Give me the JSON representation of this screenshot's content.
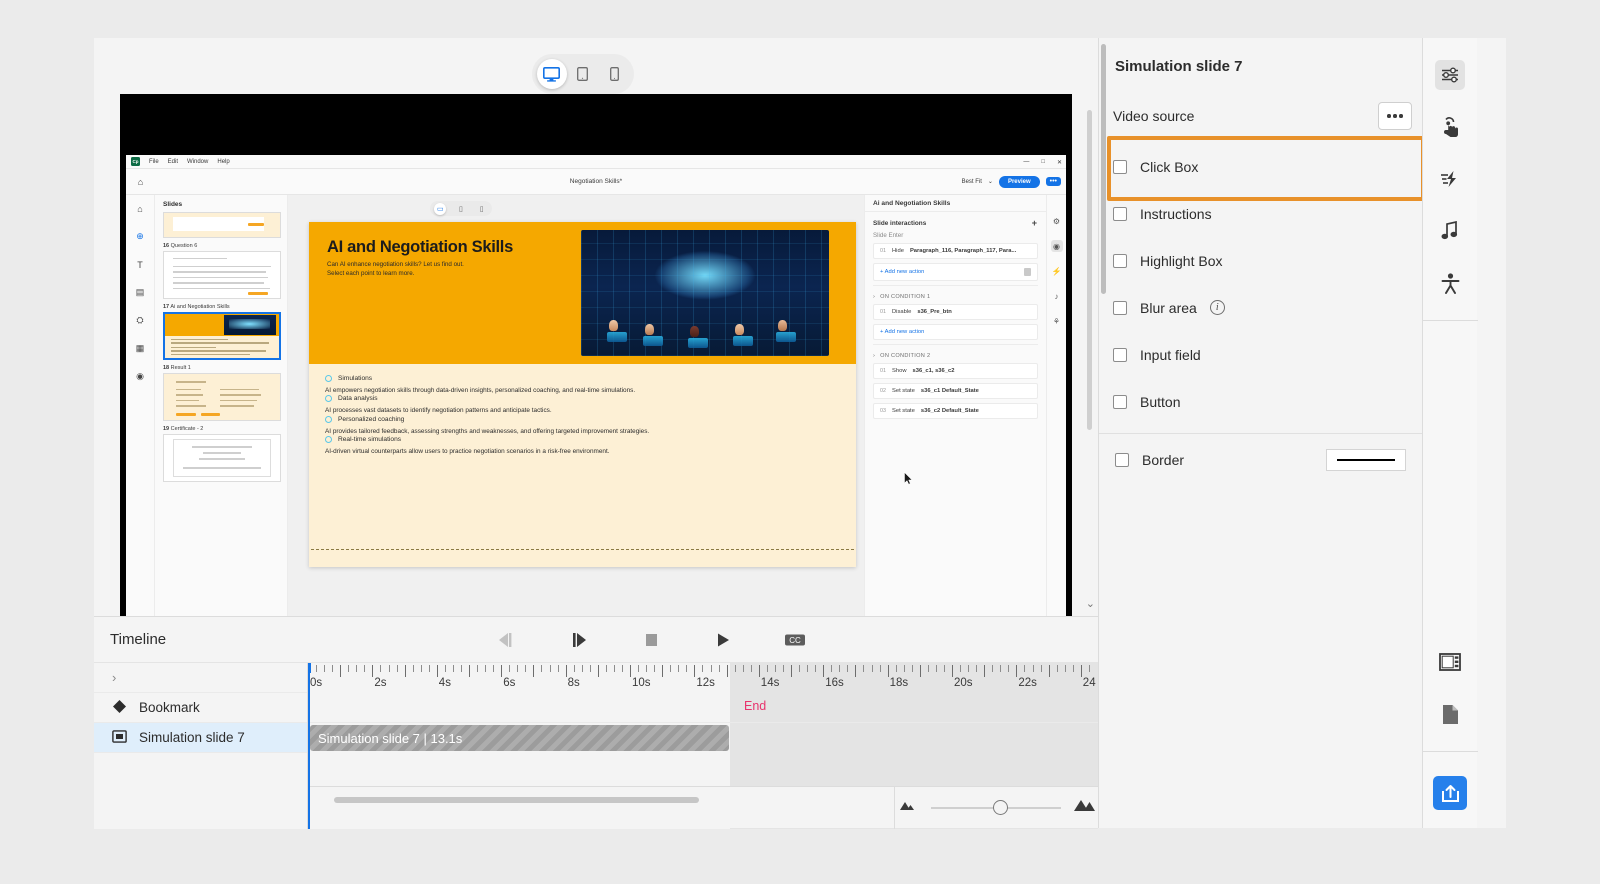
{
  "stage": {
    "devices": [
      {
        "name": "desktop",
        "label": "Desktop",
        "selected": true
      },
      {
        "name": "tablet",
        "label": "Tablet",
        "selected": false
      },
      {
        "name": "mobile",
        "label": "Mobile",
        "selected": false
      }
    ]
  },
  "inner_app": {
    "menubar": {
      "logo": "Cp",
      "items": [
        "File",
        "Edit",
        "Window",
        "Help"
      ]
    },
    "window_controls": [
      "—",
      "□",
      "✕"
    ],
    "doc_title": "Negotiation Skills*",
    "zoom_select": "Best Fit",
    "preview_label": "Preview",
    "more_label": "•••",
    "rail_icons": [
      "home-icon",
      "add-icon",
      "text-icon",
      "media-icon",
      "interaction-icon",
      "widgets-icon",
      "states-icon"
    ],
    "slides_panel": {
      "title": "Slides",
      "slides": [
        {
          "number": "",
          "label": "",
          "selected": false
        },
        {
          "number": "16",
          "label": "Question 6",
          "selected": false
        },
        {
          "number": "17",
          "label": "Ai and Negotiation Skills",
          "selected": true
        },
        {
          "number": "18",
          "label": "Result 1",
          "selected": false
        },
        {
          "number": "19",
          "label": "Certificate - 2",
          "selected": false
        }
      ]
    },
    "slide": {
      "title": "AI and Negotiation Skills",
      "subtitle_1": "Can AI enhance negotiation skills? Let us find out.",
      "subtitle_2": "Select each point to learn more.",
      "points": [
        {
          "label": "Simulations",
          "desc": "AI empowers negotiation skills through data-driven insights, personalized coaching, and real-time simulations."
        },
        {
          "label": "Data analysis",
          "desc": "AI processes vast datasets to identify negotiation patterns and anticipate tactics."
        },
        {
          "label": "Personalized coaching",
          "desc": "AI provides tailored feedback, assessing strengths and weaknesses, and offering targeted improvement strategies."
        },
        {
          "label": "Real-time simulations",
          "desc": "AI-driven virtual counterparts allow users to practice negotiation scenarios in a risk-free environment."
        }
      ]
    },
    "interactions_panel": {
      "header": "Ai and Negotiation Skills",
      "section_title": "Slide interactions",
      "add_icon": "+",
      "slide_enter_label": "Slide Enter",
      "slide_enter_actions": [
        {
          "num": "01",
          "text": "Hide",
          "bold": "Paragraph_116, Paragraph_117, Para..."
        }
      ],
      "add_new_action": "+ Add new action",
      "conditions": [
        {
          "title": "ON CONDITION 1",
          "actions": [
            {
              "num": "01",
              "text": "Disable",
              "bold": "s36_Pre_btn"
            }
          ],
          "has_add": true
        },
        {
          "title": "ON CONDITION 2",
          "actions": [
            {
              "num": "01",
              "text": "Show",
              "bold": "s36_c1, s36_c2"
            },
            {
              "num": "02",
              "text": "Set state",
              "bold": "s36_c1 Default_State"
            },
            {
              "num": "03",
              "text": "Set state",
              "bold": "s36_c2 Default_State"
            }
          ],
          "has_add": false
        }
      ],
      "rail_icons": [
        "properties-icon",
        "interactions-icon",
        "timing-icon",
        "audio-icon",
        "accessibility-icon"
      ]
    }
  },
  "timeline": {
    "title": "Timeline",
    "controls": [
      {
        "name": "previous-frame",
        "glyph": "◀|",
        "disabled": true
      },
      {
        "name": "next-frame",
        "glyph": "|▶",
        "disabled": false
      },
      {
        "name": "stop",
        "glyph": "■",
        "disabled": false
      },
      {
        "name": "play",
        "glyph": "▶",
        "disabled": false
      },
      {
        "name": "closed-captions",
        "glyph": "CC",
        "disabled": false
      }
    ],
    "expand_caret": "›",
    "ruler_labels": [
      "0s",
      "2s",
      "4s",
      "6s",
      "8s",
      "10s",
      "12s",
      "14s",
      "16s",
      "18s",
      "20s",
      "22s",
      "24"
    ],
    "rows": [
      {
        "name": "Bookmark",
        "icon": "bookmark-diamond-icon",
        "selected": false
      },
      {
        "name": "Simulation slide 7",
        "icon": "slide-icon",
        "selected": true
      }
    ],
    "end_marker": "End",
    "clip_label": "Simulation slide 7  | 13.1s",
    "clip_duration": "13.1s",
    "zoom_value": 50
  },
  "properties": {
    "title": "Simulation slide 7",
    "video_source": {
      "label": "Video source",
      "more_label": "•••",
      "highlighted": true
    },
    "highlight_color": "#e8912a",
    "checkboxes": [
      {
        "label": "Click Box",
        "checked": false,
        "info": false
      },
      {
        "label": "Instructions",
        "checked": false,
        "info": false
      },
      {
        "label": "Highlight Box",
        "checked": false,
        "info": false
      },
      {
        "label": "Blur area",
        "checked": false,
        "info": true
      },
      {
        "label": "Input field",
        "checked": false,
        "info": false
      },
      {
        "label": "Button",
        "checked": false,
        "info": false
      }
    ],
    "border": {
      "label": "Border",
      "checked": false,
      "swatch": "solid-line"
    }
  },
  "right_toolbar": {
    "top_icons": [
      {
        "name": "properties-sliders-icon",
        "selected": true
      },
      {
        "name": "interactions-touch-icon",
        "selected": false
      },
      {
        "name": "timing-bolt-icon",
        "selected": false
      },
      {
        "name": "audio-music-icon",
        "selected": false
      },
      {
        "name": "accessibility-icon",
        "selected": false
      }
    ],
    "bottom_icons": [
      {
        "name": "layout-panel-icon",
        "selected": false
      },
      {
        "name": "document-file-icon",
        "selected": false
      }
    ],
    "publish": {
      "name": "publish-upload-icon",
      "color": "#2680eb"
    }
  }
}
